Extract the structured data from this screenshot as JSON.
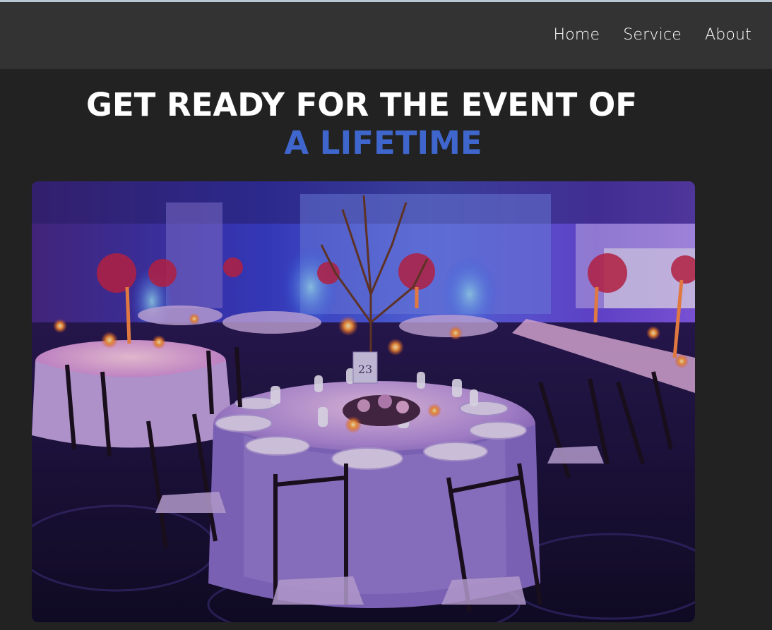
{
  "nav": {
    "links": [
      "Home",
      "Service",
      "About"
    ]
  },
  "hero": {
    "line1": "GET READY FOR THE EVENT OF",
    "line2": "A LIFETIME",
    "image_alt": "Banquet hall with round tables set for an event under purple and blue lighting",
    "table_number": "23"
  },
  "colors": {
    "page_bg": "#222222",
    "navbar_bg": "#333333",
    "accent": "#3f66cc",
    "text": "#ffffff"
  }
}
